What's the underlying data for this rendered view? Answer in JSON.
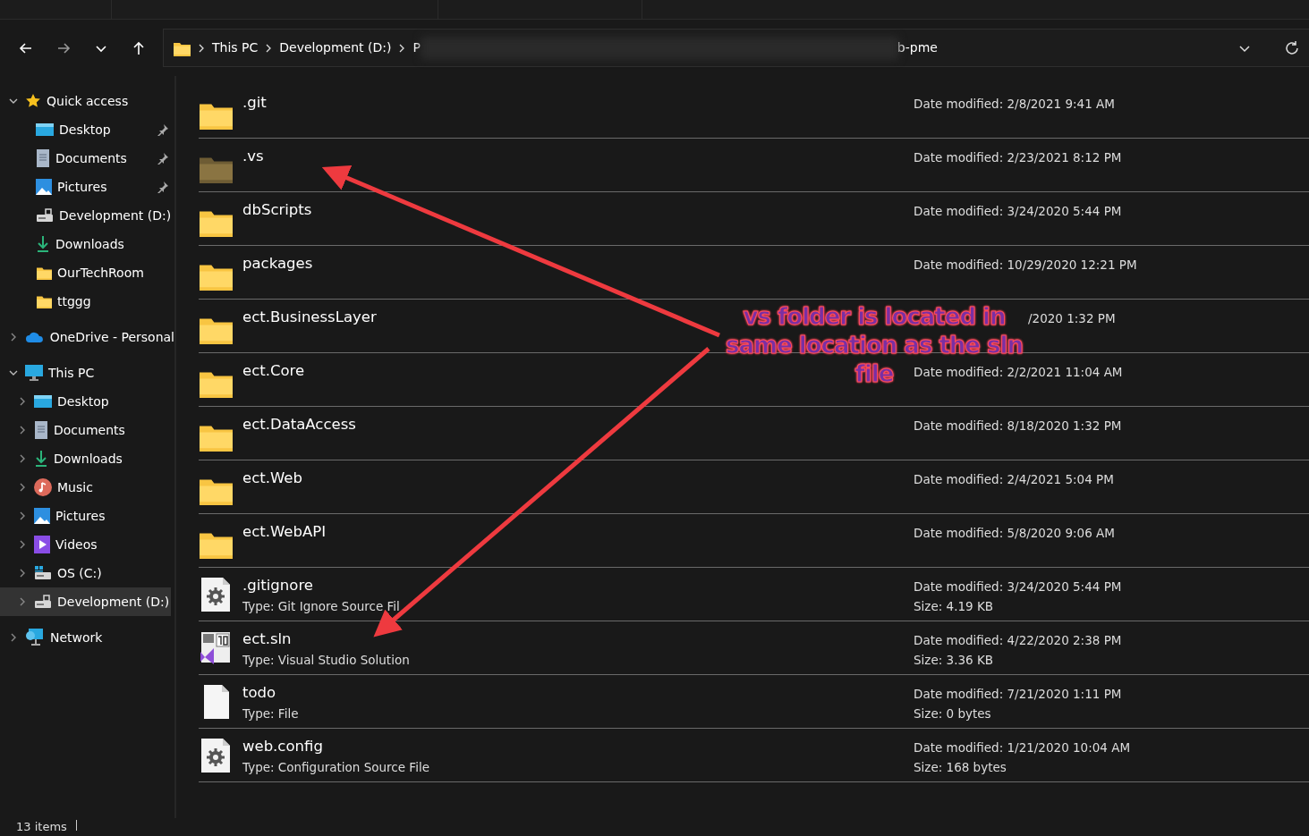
{
  "address_bar": {
    "crumbs": [
      "This PC",
      "Development (D:)",
      "P"
    ],
    "tail": "b-pme"
  },
  "sidebar": {
    "groups": [
      {
        "label": "Quick access",
        "expanded": true,
        "selected": false,
        "children": [
          {
            "label": "Desktop",
            "pinned": true,
            "selected": false
          },
          {
            "label": "Documents",
            "pinned": true,
            "selected": false
          },
          {
            "label": "Pictures",
            "pinned": true,
            "selected": false
          },
          {
            "label": "Development (D:)",
            "pinned": false,
            "selected": false
          },
          {
            "label": "Downloads",
            "pinned": false,
            "selected": false
          },
          {
            "label": "OurTechRoom",
            "pinned": false,
            "selected": false
          },
          {
            "label": "ttggg",
            "pinned": false,
            "selected": false
          }
        ]
      },
      {
        "label": "OneDrive - Personal",
        "expanded": false,
        "selected": false
      },
      {
        "label": "This PC",
        "expanded": true,
        "selected": false,
        "children": [
          {
            "label": "Desktop",
            "expanded": false,
            "selected": false
          },
          {
            "label": "Documents",
            "expanded": false,
            "selected": false
          },
          {
            "label": "Downloads",
            "expanded": false,
            "selected": false
          },
          {
            "label": "Music",
            "expanded": false,
            "selected": false
          },
          {
            "label": "Pictures",
            "expanded": false,
            "selected": false
          },
          {
            "label": "Videos",
            "expanded": false,
            "selected": false
          },
          {
            "label": "OS (C:)",
            "expanded": false,
            "selected": false
          },
          {
            "label": "Development (D:)",
            "expanded": false,
            "selected": true
          }
        ]
      },
      {
        "label": "Network",
        "expanded": false,
        "selected": false
      }
    ]
  },
  "files": [
    {
      "name": ".git",
      "kind": "folder",
      "hidden": false,
      "modified": "Date modified: 2/8/2021 9:41 AM"
    },
    {
      "name": ".vs",
      "kind": "folder",
      "hidden": true,
      "modified": "Date modified: 2/23/2021 8:12 PM"
    },
    {
      "name": "dbScripts",
      "kind": "folder",
      "hidden": false,
      "modified": "Date modified: 3/24/2020 5:44 PM"
    },
    {
      "name": "packages",
      "kind": "folder",
      "hidden": false,
      "modified": "Date modified: 10/29/2020 12:21 PM"
    },
    {
      "name": "ect.BusinessLayer",
      "kind": "folder",
      "hidden": false,
      "modified": "/2020 1:32 PM"
    },
    {
      "name": "ect.Core",
      "kind": "folder",
      "hidden": false,
      "modified": "Date modified: 2/2/2021 11:04 AM"
    },
    {
      "name": "ect.DataAccess",
      "kind": "folder",
      "hidden": false,
      "modified": "Date modified: 8/18/2020 1:32 PM"
    },
    {
      "name": "ect.Web",
      "kind": "folder",
      "hidden": false,
      "modified": "Date modified: 2/4/2021 5:04 PM"
    },
    {
      "name": "ect.WebAPI",
      "kind": "folder",
      "hidden": false,
      "modified": "Date modified: 5/8/2020 9:06 AM"
    },
    {
      "name": ".gitignore",
      "kind": "config",
      "type": "Type: Git Ignore Source Fil",
      "modified": "Date modified: 3/24/2020 5:44 PM",
      "size": "Size: 4.19 KB"
    },
    {
      "name": "ect.sln",
      "kind": "solution",
      "type": "Type: Visual Studio Solution",
      "modified": "Date modified: 4/22/2020 2:38 PM",
      "size": "Size: 3.36 KB"
    },
    {
      "name": "todo",
      "kind": "plain",
      "type": "Type: File",
      "modified": "Date modified: 7/21/2020 1:11 PM",
      "size": "Size: 0 bytes"
    },
    {
      "name": "web.config",
      "kind": "config",
      "type": "Type: Configuration Source File",
      "modified": "Date modified: 1/21/2020 10:04 AM",
      "size": "Size: 168 bytes"
    }
  ],
  "annotation": {
    "lines": [
      "vs folder is located in",
      "same location as the sln",
      "file"
    ]
  },
  "status_bar": {
    "count": "13 items"
  }
}
